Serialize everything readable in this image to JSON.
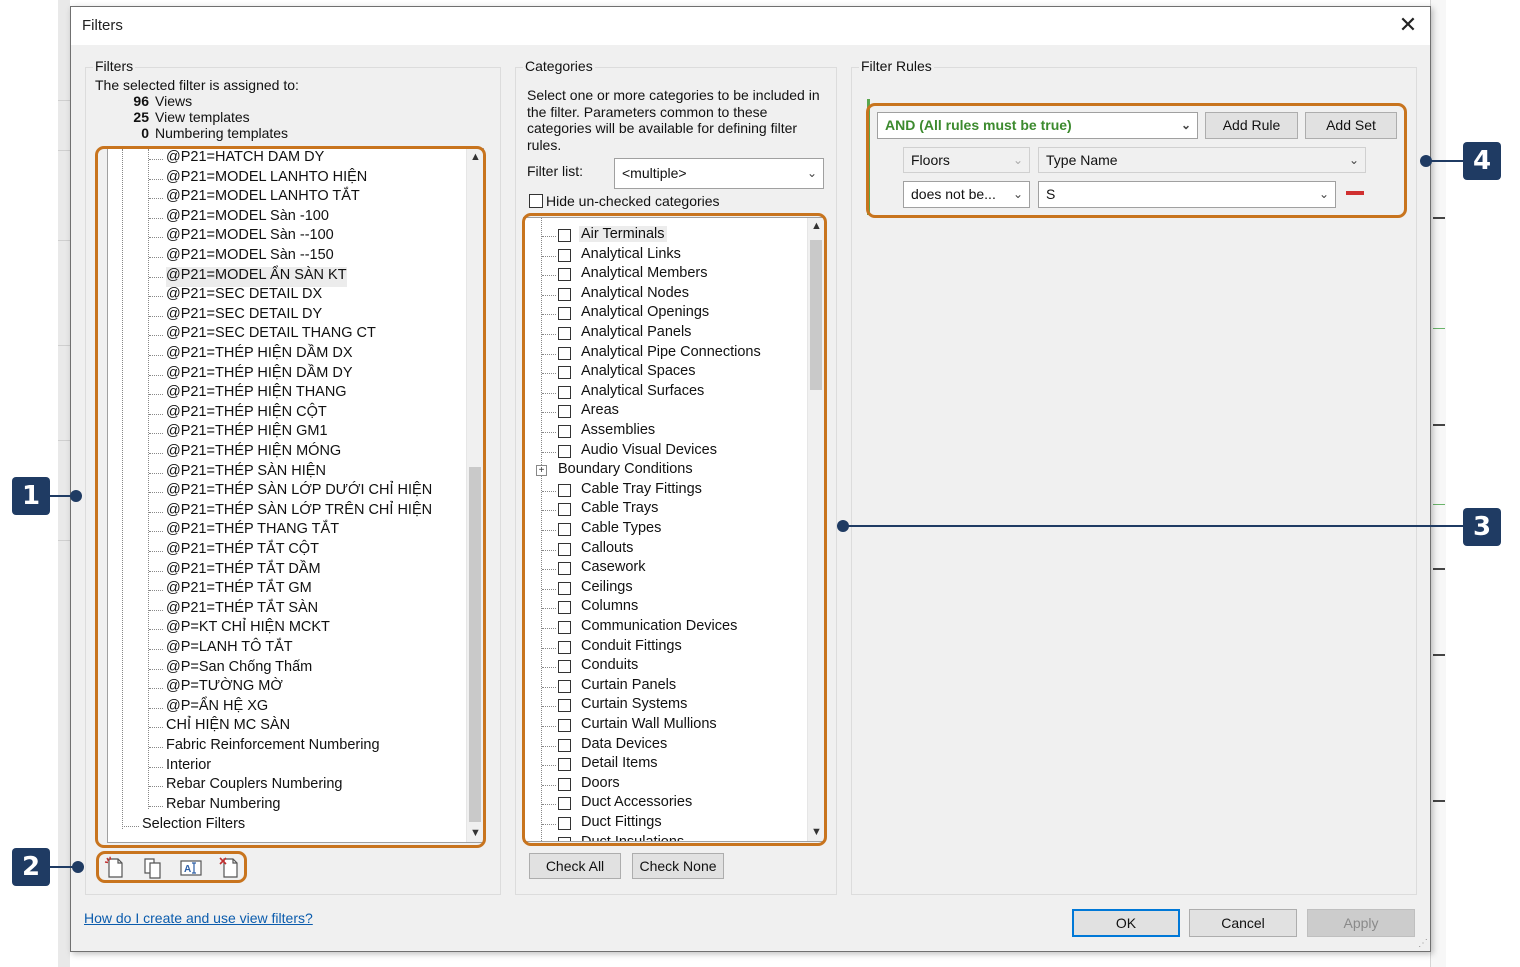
{
  "dialog": {
    "title": "Filters",
    "close_symbol": "✕",
    "help_link": "How do I create and use view filters?",
    "ok_label": "OK",
    "cancel_label": "Cancel",
    "apply_label": "Apply"
  },
  "filters_panel": {
    "group_label": "Filters",
    "assigned_label": "The selected filter is assigned to:",
    "views_count": "96",
    "views_label": "Views",
    "templates_count": "25",
    "templates_label": "View templates",
    "numbering_count": "0",
    "numbering_label": "Numbering templates",
    "items": [
      "@P21=HATCH DAM DY",
      "@P21=MODEL LANHTO HIỆN",
      "@P21=MODEL LANHTO TẮT",
      "@P21=MODEL Sàn -100",
      "@P21=MODEL Sàn --100",
      "@P21=MODEL Sàn --150",
      "@P21=MODEL ẨN SÀN KT",
      "@P21=SEC DETAIL DX",
      "@P21=SEC DETAIL DY",
      "@P21=SEC DETAIL THANG CT",
      "@P21=THÉP  HIỆN  DẦM DX",
      "@P21=THÉP  HIỆN  DẦM DY",
      "@P21=THÉP  HIỆN  THANG",
      "@P21=THÉP HIỆN CỘT",
      "@P21=THÉP HIỆN GM1",
      "@P21=THÉP HIỆN MÓNG",
      "@P21=THÉP SÀN HIỆN",
      "@P21=THÉP SÀN LỚP DƯỚI CHỈ HIỆN",
      "@P21=THÉP SÀN LỚP TRÊN CHỈ HIỆN",
      "@P21=THÉP THANG TẮT",
      "@P21=THÉP TẮT  CỘT",
      "@P21=THÉP TẮT  DẦM",
      "@P21=THÉP TẮT GM",
      "@P21=THÉP TẮT SÀN",
      "@P=KT CHỈ HIỆN MCKT",
      "@P=LANH TÔ TẮT",
      "@P=San Chống Thấm",
      "@P=TƯỜNG MỜ",
      "@P=ẨN HỆ XG",
      "CHỈ HIỆN MC SÀN",
      "Fabric Reinforcement Numbering",
      "Interior",
      "Rebar Couplers Numbering",
      "Rebar Numbering"
    ],
    "selection_filters": "Selection Filters"
  },
  "categories_panel": {
    "group_label": "Categories",
    "description": "Select one or more categories to be included in the filter.  Parameters common to these categories will be available for defining filter rules.",
    "filter_list_label": "Filter list:",
    "filter_list_value": "<multiple>",
    "hide_unchecked_label": "Hide un-checked categories",
    "items": [
      "Air Terminals",
      "Analytical Links",
      "Analytical Members",
      "Analytical Nodes",
      "Analytical Openings",
      "Analytical Panels",
      "Analytical Pipe Connections",
      "Analytical Spaces",
      "Analytical Surfaces",
      "Areas",
      "Assemblies",
      "Audio Visual Devices",
      "Boundary Conditions",
      "Cable Tray Fittings",
      "Cable Trays",
      "Cable Types",
      "Callouts",
      "Casework",
      "Ceilings",
      "Columns",
      "Communication Devices",
      "Conduit Fittings",
      "Conduits",
      "Curtain Panels",
      "Curtain Systems",
      "Curtain Wall Mullions",
      "Data Devices",
      "Detail Items",
      "Doors",
      "Duct Accessories",
      "Duct Fittings",
      "Duct Insulations"
    ],
    "check_all_label": "Check All",
    "check_none_label": "Check None"
  },
  "rules_panel": {
    "group_label": "Filter Rules",
    "logic_value": "AND (All rules must be true)",
    "add_rule_label": "Add Rule",
    "add_set_label": "Add Set",
    "category_value": "Floors",
    "parameter_value": "Type Name",
    "operator_value": "does not be...",
    "rule_value": "S"
  },
  "toolbar_icons": [
    "new-filter-icon",
    "duplicate-filter-icon",
    "rename-filter-icon",
    "delete-filter-icon"
  ],
  "annotations": {
    "badge_1": "1",
    "badge_2": "2",
    "badge_3": "3",
    "badge_4": "4"
  },
  "colors": {
    "highlight": "#c8741e",
    "badge": "#1f3b63",
    "logic_green": "#3c8a2e",
    "ok_border": "#0078d7",
    "link": "#0b5cad"
  }
}
